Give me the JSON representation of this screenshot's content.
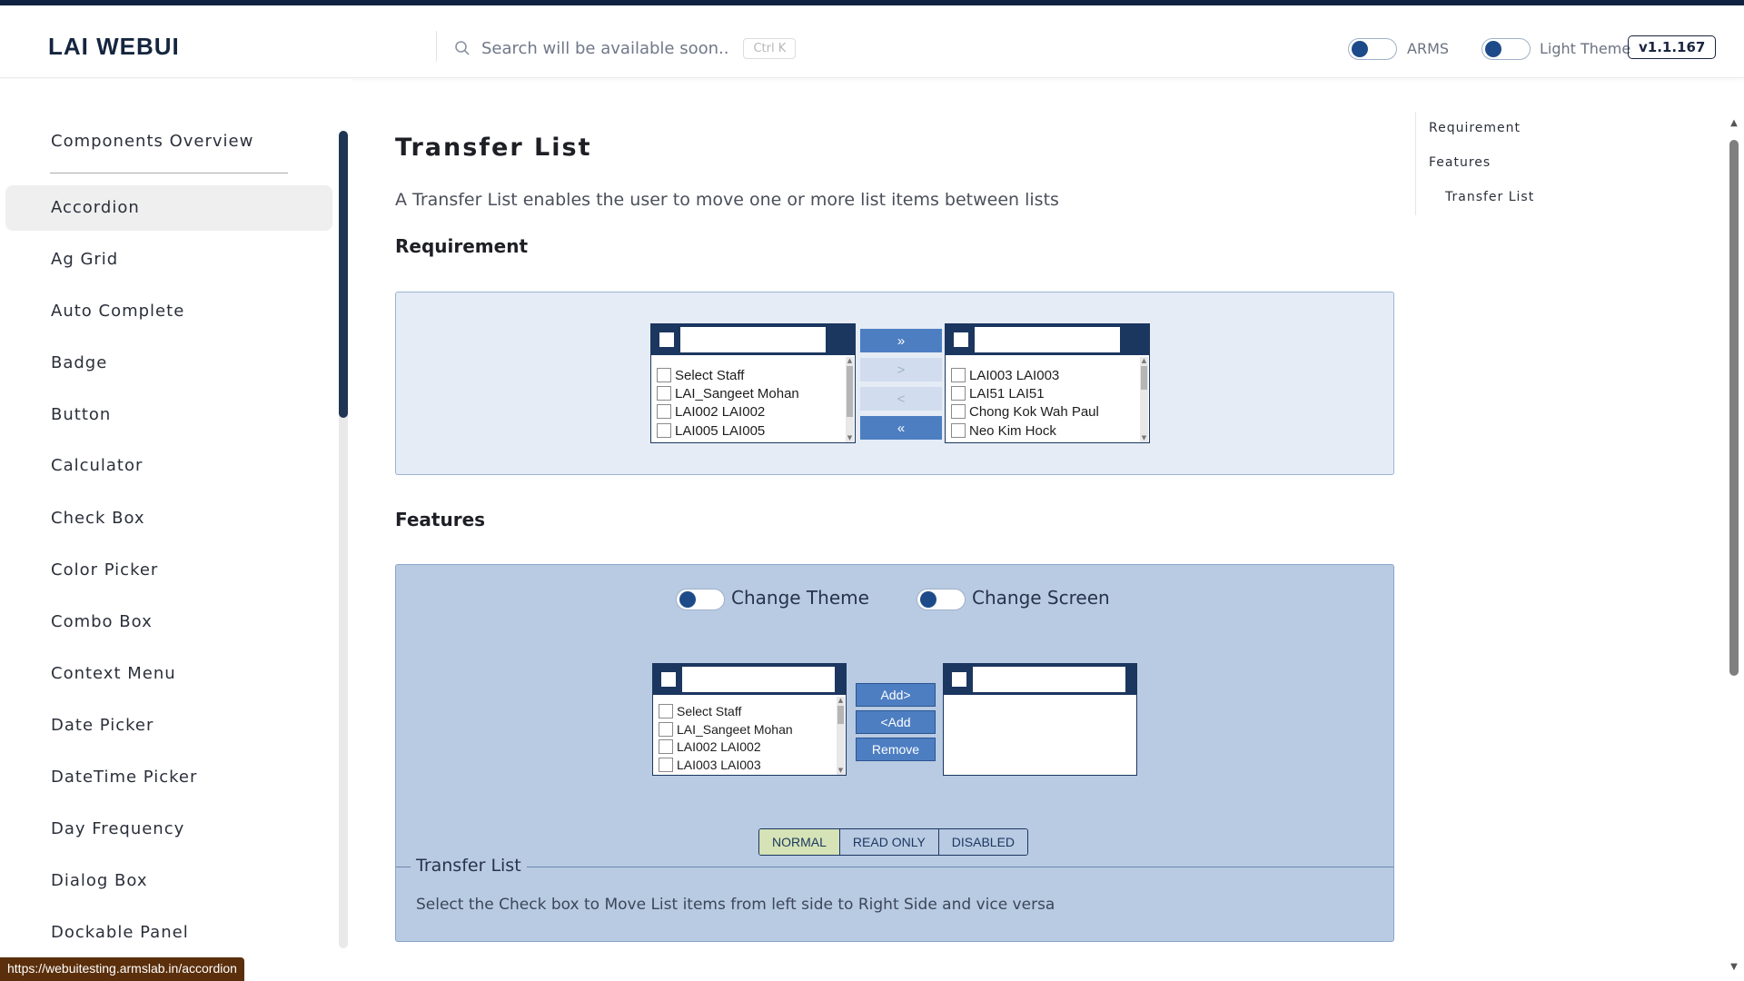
{
  "header": {
    "brand": "LAI WEBUI",
    "search_placeholder": "Search will be available soon..",
    "search_shortcut": "Ctrl K",
    "toggle_arms_label": "ARMS",
    "toggle_theme_label": "Light Theme",
    "version": "v1.1.167"
  },
  "sidebar": {
    "top_item": "Components Overview",
    "items": [
      {
        "label": "Accordion",
        "active": true
      },
      {
        "label": "Ag Grid"
      },
      {
        "label": "Auto Complete"
      },
      {
        "label": "Badge"
      },
      {
        "label": "Button"
      },
      {
        "label": "Calculator"
      },
      {
        "label": "Check Box"
      },
      {
        "label": "Color Picker"
      },
      {
        "label": "Combo Box"
      },
      {
        "label": "Context Menu"
      },
      {
        "label": "Date Picker"
      },
      {
        "label": "DateTime Picker"
      },
      {
        "label": "Day Frequency"
      },
      {
        "label": "Dialog Box"
      },
      {
        "label": "Dockable Panel"
      }
    ]
  },
  "main": {
    "title": "Transfer List",
    "description": "A Transfer List enables the user to move one or more list items between lists",
    "requirement_heading": "Requirement",
    "features_heading": "Features",
    "requirement_demo": {
      "left_items": [
        "Select Staff",
        "LAI_Sangeet Mohan",
        "LAI002 LAI002",
        "LAI005 LAI005"
      ],
      "right_items": [
        "LAI003 LAI003",
        "LAI51 LAI51",
        "Chong Kok Wah Paul",
        "Neo Kim Hock"
      ],
      "buttons": {
        "move_all_right": "»",
        "move_right": ">",
        "move_left": "<",
        "move_all_left": "«"
      }
    },
    "features_demo": {
      "toggle_theme_label": "Change Theme",
      "toggle_screen_label": "Change Screen",
      "left_items": [
        "Select Staff",
        "LAI_Sangeet Mohan",
        "LAI002 LAI002",
        "LAI003 LAI003"
      ],
      "right_items": [],
      "buttons": {
        "add_right": "Add>",
        "add_left": "<Add",
        "remove": "Remove"
      },
      "modes": [
        "NORMAL",
        "READ ONLY",
        "DISABLED"
      ],
      "selected_mode": "NORMAL",
      "legend_title": "Transfer List",
      "legend_text": "Select the Check box to Move List items from left side to Right Side and vice versa"
    }
  },
  "toc": {
    "items": [
      "Requirement",
      "Features",
      "Transfer List"
    ]
  },
  "statusbar": {
    "url": "https://webuitesting.armslab.in/accordion"
  },
  "colors": {
    "navy": "#1b365f",
    "button_blue": "#4d7ec2",
    "features_bg": "#b8cbe3",
    "requirement_bg": "#e5ecf6",
    "normal_mode_bg": "#d5e3b6"
  }
}
